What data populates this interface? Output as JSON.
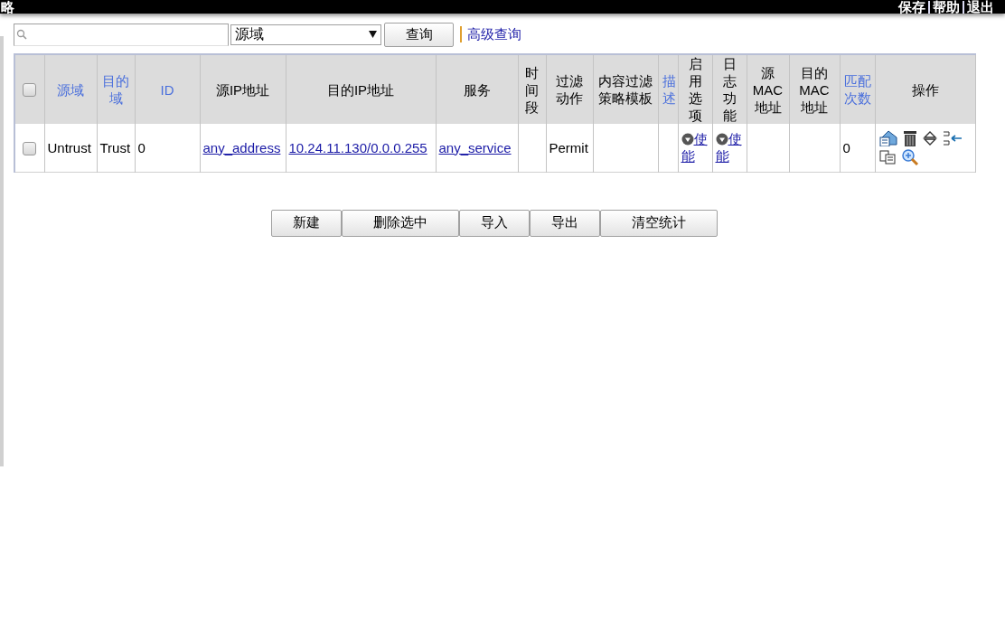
{
  "header": {
    "title": "略",
    "links": [
      "保存",
      "帮助",
      "退出"
    ]
  },
  "search": {
    "scope": "源域",
    "button": "查询",
    "advanced_link": "高级查询"
  },
  "table": {
    "select_all": {
      "checked": false
    },
    "columns": [
      {
        "label": "源域",
        "sortable": true
      },
      {
        "label": "目的域",
        "sortable": true
      },
      {
        "label": "ID",
        "sortable": true
      },
      {
        "label": "源IP地址",
        "sortable": false
      },
      {
        "label": "目的IP地址",
        "sortable": false
      },
      {
        "label": "服务",
        "sortable": false
      },
      {
        "label": "时间段",
        "sortable": false
      },
      {
        "label": "过滤动作",
        "sortable": false
      },
      {
        "label": "内容过滤策略模板",
        "sortable": false
      },
      {
        "label": "描述",
        "sortable": true
      },
      {
        "label": "启用选项",
        "sortable": false
      },
      {
        "label": "日志功能",
        "sortable": false
      },
      {
        "label": "源MAC地址",
        "sortable": false
      },
      {
        "label": "目的MAC地址",
        "sortable": false
      },
      {
        "label": "匹配次数",
        "sortable": true
      },
      {
        "label": "操作",
        "sortable": false
      }
    ],
    "rows": [
      {
        "checked": false,
        "cells": [
          {
            "kind": "text",
            "text": "Untrust"
          },
          {
            "kind": "text",
            "text": "Trust"
          },
          {
            "kind": "text",
            "text": "0"
          },
          {
            "kind": "link",
            "text": "any_address"
          },
          {
            "kind": "link",
            "text": "10.24.11.130/0.0.0.255"
          },
          {
            "kind": "link",
            "text": "any_service"
          },
          {
            "kind": "empty"
          },
          {
            "kind": "text",
            "text": "Permit"
          },
          {
            "kind": "empty"
          },
          {
            "kind": "empty"
          },
          {
            "kind": "toggle",
            "text": "使能"
          },
          {
            "kind": "toggle",
            "text": "使能"
          },
          {
            "kind": "empty"
          },
          {
            "kind": "empty"
          },
          {
            "kind": "text",
            "text": "0"
          },
          {
            "kind": "actions"
          }
        ]
      }
    ]
  },
  "buttons": [
    "新建",
    "删除选中",
    "导入",
    "导出",
    "清空统计"
  ]
}
